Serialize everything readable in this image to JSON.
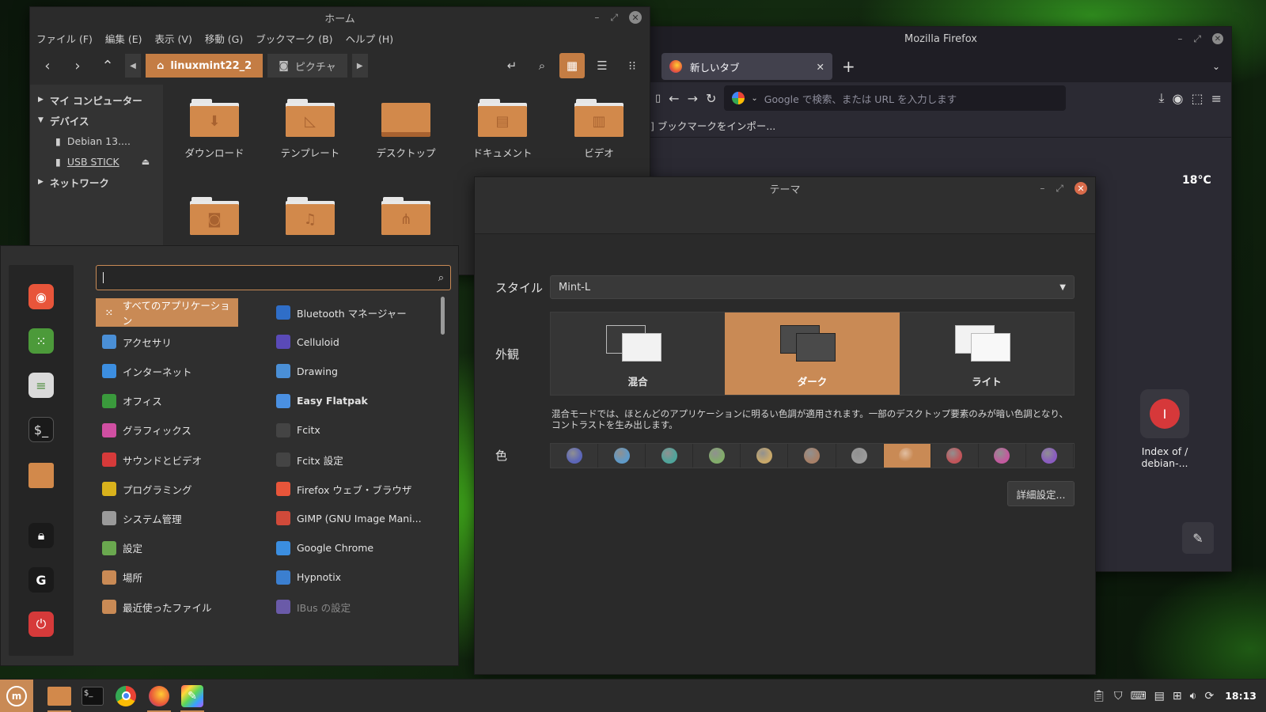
{
  "file_manager": {
    "title": "ホーム",
    "menu": [
      "ファイル (F)",
      "編集 (E)",
      "表示 (V)",
      "移動 (G)",
      "ブックマーク (B)",
      "ヘルプ (H)"
    ],
    "path_active": "linuxmint22_2",
    "path_next": "ピクチャ",
    "sidebar": {
      "my_computer": "マイ コンピューター",
      "devices": "デバイス",
      "device_1": "Debian 13....",
      "device_2": "USB STICK",
      "network": "ネットワーク"
    },
    "folders": [
      "ダウンロード",
      "テンプレート",
      "デスクトップ",
      "ドキュメント",
      "ビデオ"
    ]
  },
  "firefox": {
    "title": "Mozilla Firefox",
    "tab_label": "新しいタブ",
    "url_placeholder": "Google で検索、または URL を入力します",
    "bookmark_text": "] ブックマークをインポー..."
  },
  "theme_window": {
    "title": "テーマ",
    "style_label": "スタイル",
    "style_value": "Mint-L",
    "appearance_label": "外観",
    "appearance_options": [
      "混合",
      "ダーク",
      "ライト"
    ],
    "appearance_selected": "ダーク",
    "description": "混合モードでは、ほとんどのアプリケーションに明るい色調が適用されます。一部のデスクトップ要素のみが暗い色調となり、コントラストを生み出します。",
    "color_label": "色",
    "colors": [
      "#5c66b8",
      "#5f9ac8",
      "#4fa49a",
      "#82ac6a",
      "#c8a86a",
      "#a78068",
      "#9a9a9a",
      "#c98a55",
      "#c0555a",
      "#c35a9e",
      "#8a5cc0"
    ],
    "color_selected_index": 7,
    "advanced_button": "詳細設定..."
  },
  "start_menu": {
    "search_value": "",
    "categories": [
      {
        "label": "すべてのアプリケーション",
        "icon": "grid-icon",
        "color": "#c98a55"
      },
      {
        "label": "アクセサリ",
        "icon": "accessories-icon",
        "color": "#4a8fd6"
      },
      {
        "label": "インターネット",
        "icon": "cloud-icon",
        "color": "#3c8ee0"
      },
      {
        "label": "オフィス",
        "icon": "office-icon",
        "color": "#3a9a3c"
      },
      {
        "label": "グラフィックス",
        "icon": "graphics-icon",
        "color": "#d04fa2"
      },
      {
        "label": "サウンドとビデオ",
        "icon": "play-icon",
        "color": "#d63a3a"
      },
      {
        "label": "プログラミング",
        "icon": "programming-icon",
        "color": "#d9b21c"
      },
      {
        "label": "システム管理",
        "icon": "system-icon",
        "color": "#9a9a9a"
      },
      {
        "label": "設定",
        "icon": "settings-icon",
        "color": "#6aa84f"
      },
      {
        "label": "場所",
        "icon": "folder-icon",
        "color": "#c98a55"
      },
      {
        "label": "最近使ったファイル",
        "icon": "recent-icon",
        "color": "#c98a55"
      }
    ],
    "apps": [
      {
        "label": "Bluetooth マネージャー",
        "icon": "bluetooth-icon",
        "color": "#2f6ec8"
      },
      {
        "label": "Celluloid",
        "icon": "celluloid-icon",
        "color": "#5a4ab8"
      },
      {
        "label": "Drawing",
        "icon": "drawing-icon",
        "color": "#4a8fd6"
      },
      {
        "label": "Easy Flatpak",
        "icon": "flatpak-icon",
        "color": "#4a90e2"
      },
      {
        "label": "Fcitx",
        "icon": "penguin-icon",
        "color": "#444444"
      },
      {
        "label": "Fcitx 設定",
        "icon": "penguin-icon",
        "color": "#444444"
      },
      {
        "label": "Firefox ウェブ・ブラウザ",
        "icon": "firefox-icon",
        "color": "#e8553a"
      },
      {
        "label": "GIMP (GNU Image Mani...",
        "icon": "gimp-icon",
        "color": "#d04a3a"
      },
      {
        "label": "Google Chrome",
        "icon": "chrome-icon",
        "color": "#3b8ee0"
      },
      {
        "label": "Hypnotix",
        "icon": "hypnotix-icon",
        "color": "#3b7fd0"
      },
      {
        "label": "IBus の設定",
        "icon": "info-icon",
        "color": "#6a5aa8"
      }
    ]
  },
  "desktop": {
    "temperature": "18°C",
    "shortcut_label_1": "Index of /",
    "shortcut_label_2": "debian-..."
  },
  "taskbar": {
    "clock": "18:13"
  }
}
